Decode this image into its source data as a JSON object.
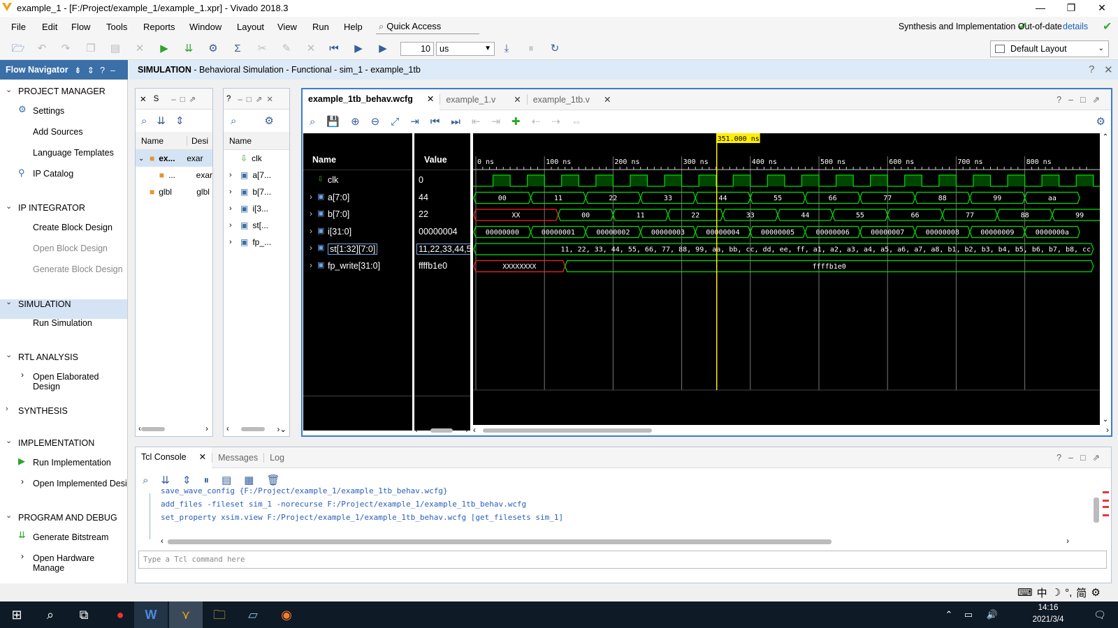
{
  "window": {
    "title": "example_1 - [F:/Project/example_1/example_1.xpr] - Vivado 2018.3",
    "minimize": "—",
    "restore": "❐",
    "close": "✕"
  },
  "menu": [
    "File",
    "Edit",
    "Flow",
    "Tools",
    "Reports",
    "Window",
    "Layout",
    "View",
    "Run",
    "Help"
  ],
  "quick_access": "Quick Access",
  "status": {
    "text": "Synthesis and Implementation Out-of-date",
    "link": "details"
  },
  "toolbar": {
    "time_value": "10",
    "time_unit": "us",
    "layout": "Default Layout"
  },
  "flow_navigator": {
    "title": "Flow Navigator",
    "sections": [
      {
        "label": "PROJECT MANAGER",
        "items": [
          "Settings",
          "Add Sources",
          "Language Templates",
          "IP Catalog"
        ]
      },
      {
        "label": "IP INTEGRATOR",
        "items": [
          "Create Block Design",
          "Open Block Design",
          "Generate Block Design"
        ]
      },
      {
        "label": "SIMULATION",
        "items": [
          "Run Simulation"
        ]
      },
      {
        "label": "RTL ANALYSIS",
        "items": [
          "Open Elaborated Design"
        ]
      },
      {
        "label": "SYNTHESIS",
        "items": []
      },
      {
        "label": "IMPLEMENTATION",
        "items": [
          "Run Implementation",
          "Open Implemented Desi"
        ]
      },
      {
        "label": "PROGRAM AND DEBUG",
        "items": [
          "Generate Bitstream",
          "Open Hardware Manage"
        ]
      }
    ]
  },
  "sim_header": {
    "bold": "SIMULATION",
    "rest": " - Behavioral Simulation - Functional - sim_1 - example_1tb"
  },
  "scope_panel": {
    "tab": "S",
    "cols": [
      "Name",
      "Desi"
    ],
    "rows": [
      [
        "ex...",
        "exar"
      ],
      [
        "...",
        "exar"
      ],
      [
        "glbl",
        "glbl"
      ]
    ]
  },
  "objects_panel": {
    "tab": "?",
    "col": "Name",
    "rows": [
      "clk",
      "a[7...",
      "b[7...",
      "i[3...",
      "st[...",
      "fp_..."
    ]
  },
  "wave_tabs": [
    "example_1tb_behav.wcfg",
    "example_1.v",
    "example_1tb.v"
  ],
  "wave": {
    "cursor": "351.000 ns",
    "name_header": "Name",
    "value_header": "Value",
    "signals": [
      {
        "name": "clk",
        "value": "0"
      },
      {
        "name": "a[7:0]",
        "value": "44"
      },
      {
        "name": "b[7:0]",
        "value": "22"
      },
      {
        "name": "i[31:0]",
        "value": "00000004"
      },
      {
        "name": "st[1:32][7:0]",
        "value": "11,22,33,44,5"
      },
      {
        "name": "fp_write[31:0]",
        "value": "ffffb1e0"
      }
    ],
    "time_ticks": [
      "0 ns",
      "100 ns",
      "200 ns",
      "300 ns",
      "400 ns",
      "500 ns",
      "600 ns",
      "700 ns",
      "800 ns"
    ],
    "a_values": [
      "00",
      "11",
      "22",
      "33",
      "44",
      "55",
      "66",
      "77",
      "88",
      "99",
      "aa"
    ],
    "b_values": [
      "XX",
      "00",
      "11",
      "22",
      "33",
      "44",
      "55",
      "66",
      "77",
      "88",
      "99"
    ],
    "i_values": [
      "00000000",
      "00000001",
      "00000002",
      "00000003",
      "00000004",
      "00000005",
      "00000006",
      "00000007",
      "00000008",
      "00000009",
      "0000000a"
    ],
    "st_text": "11, 22, 33, 44, 55, 66, 77, 88, 99, aa, bb, cc, dd, ee, ff, a1, a2, a3, a4, a5, a6, a7, a8, b1, b2, b3, b4, b5, b6, b7, b8, cc",
    "fp_values": [
      "XXXXXXXX",
      "ffffb1e0"
    ]
  },
  "console": {
    "tabs": [
      "Tcl Console",
      "Messages",
      "Log"
    ],
    "lines": [
      "save_wave_config {F:/Project/example_1/example_1tb_behav.wcfg}",
      "add_files -fileset sim_1 -norecurse F:/Project/example_1/example_1tb_behav.wcfg",
      "set_property xsim.view F:/Project/example_1/example_1tb_behav.wcfg [get_filesets sim_1]"
    ],
    "placeholder": "Type a Tcl command here"
  },
  "taskbar": {
    "time": "14:16",
    "date": "2021/3/4",
    "ime": "中",
    "ime2": "简"
  },
  "colors": {
    "wave_green": "#00e000",
    "wave_red": "#ff2020",
    "cursor": "#ffee00",
    "accent": "#3a7cd1"
  }
}
